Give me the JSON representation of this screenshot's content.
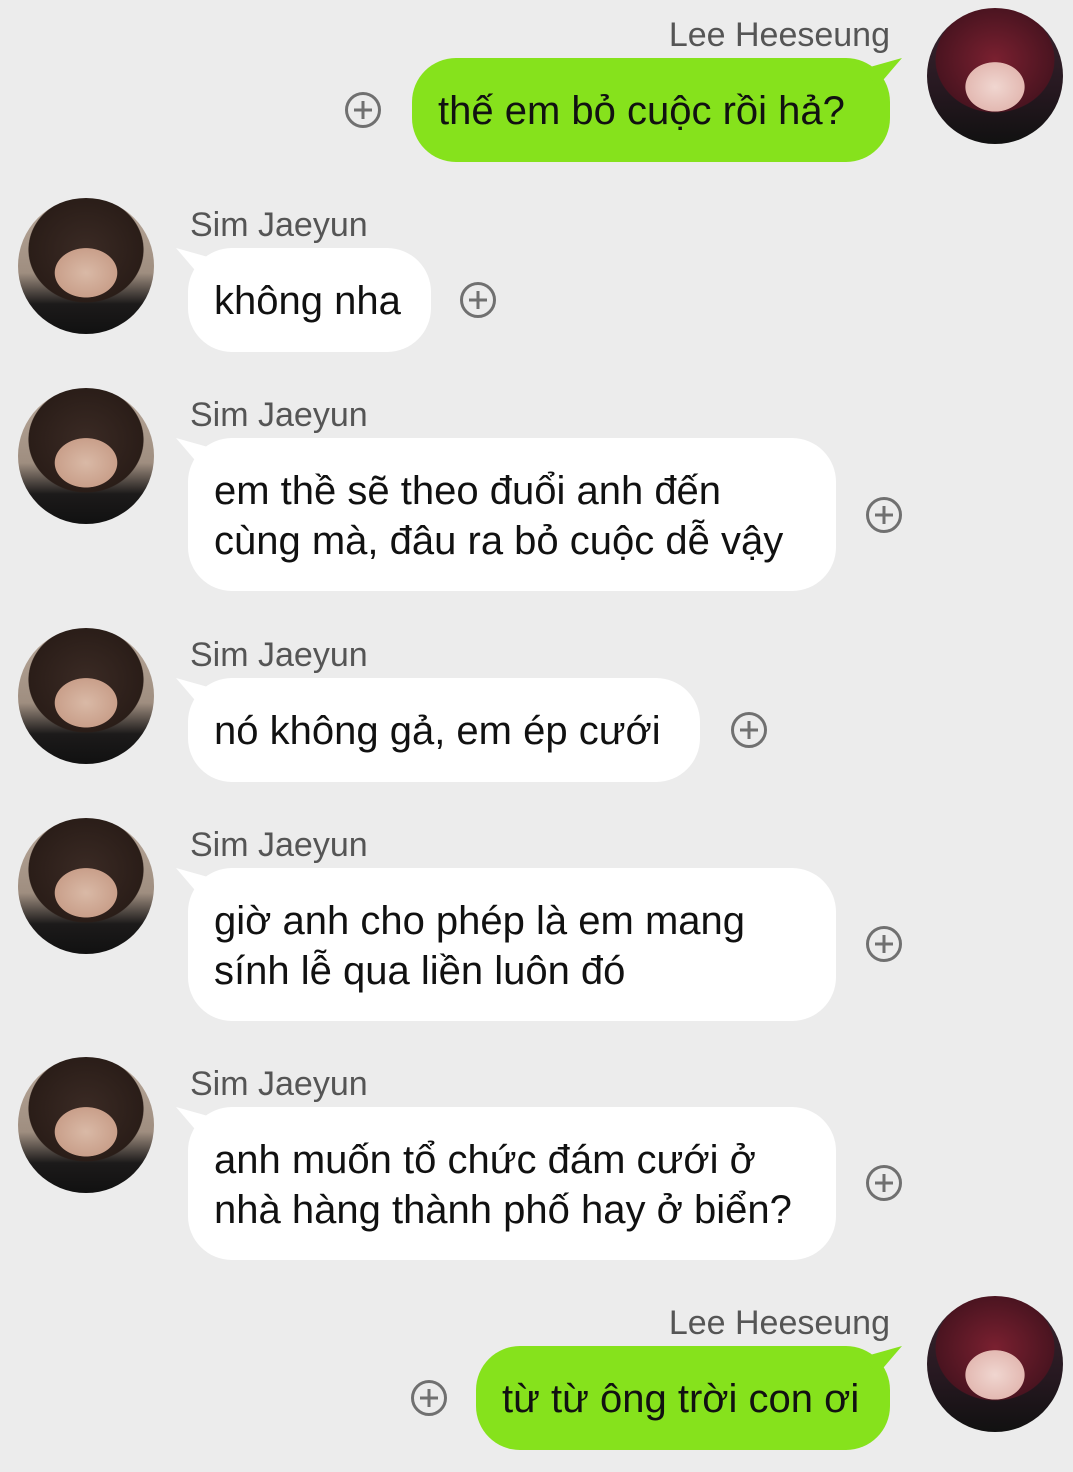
{
  "chat": {
    "messages": [
      {
        "sender": "Lee Heeseung",
        "side": "right",
        "lines": [
          "thế em bỏ cuộc rồi hả?"
        ]
      },
      {
        "sender": "Sim Jaeyun",
        "side": "left",
        "lines": [
          "không nha"
        ]
      },
      {
        "sender": "Sim Jaeyun",
        "side": "left",
        "lines": [
          "em thề sẽ theo đuổi anh đến",
          "cùng mà, đâu ra bỏ cuộc dễ vậy"
        ]
      },
      {
        "sender": "Sim Jaeyun",
        "side": "left",
        "lines": [
          "nó không gả, em ép cưới"
        ]
      },
      {
        "sender": "Sim Jaeyun",
        "side": "left",
        "lines": [
          "giờ anh cho phép là em mang",
          "sính lễ qua liền luôn đó"
        ]
      },
      {
        "sender": "Sim Jaeyun",
        "side": "left",
        "lines": [
          "anh muốn tổ chức đám cưới ở",
          "nhà hàng thành phố hay ở biển?"
        ]
      },
      {
        "sender": "Lee Heeseung",
        "side": "right",
        "lines": [
          "từ từ ông trời con ơi"
        ]
      }
    ]
  },
  "colors": {
    "background": "#ececec",
    "outgoing_bubble": "#86e21c",
    "incoming_bubble": "#ffffff"
  },
  "icons": {
    "add": "plus-circle-icon",
    "avatar": "profile-photo"
  }
}
